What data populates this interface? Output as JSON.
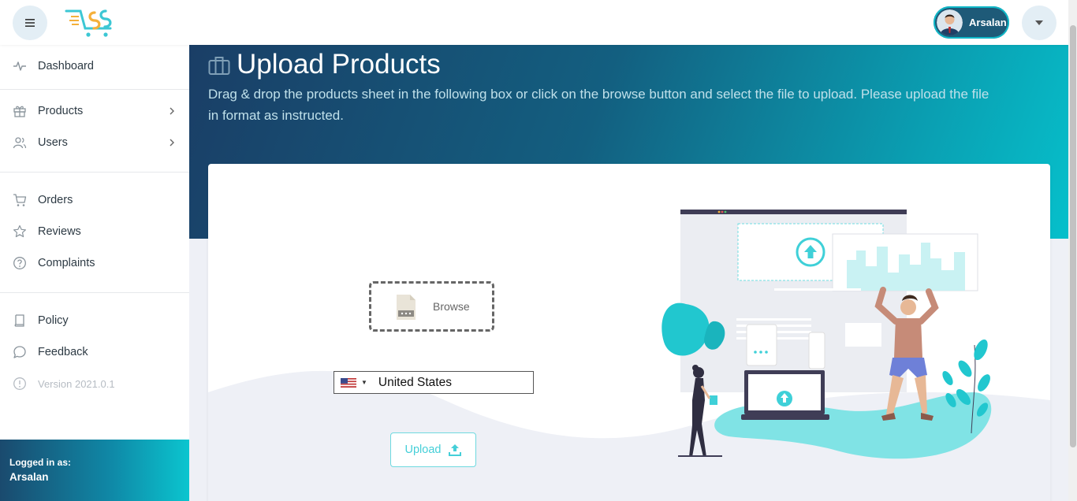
{
  "header": {
    "user_name": "Arsalan"
  },
  "sidebar": {
    "items": [
      {
        "label": "Dashboard",
        "icon": "activity-icon"
      },
      {
        "label": "Products",
        "icon": "gift-icon"
      },
      {
        "label": "Users",
        "icon": "users-icon"
      },
      {
        "label": "Orders",
        "icon": "cart-icon"
      },
      {
        "label": "Reviews",
        "icon": "star-icon"
      },
      {
        "label": "Complaints",
        "icon": "help-circle-icon"
      },
      {
        "label": "Policy",
        "icon": "book-icon"
      },
      {
        "label": "Feedback",
        "icon": "message-circle-icon"
      }
    ],
    "version": "Version 2021.0.1",
    "logged_in_label": "Logged in as:",
    "logged_in_user": "Arsalan"
  },
  "page": {
    "title": "Upload Products",
    "description": "Drag & drop the products sheet in the following box or click on the browse button and select the file to upload. Please upload the file in format as instructed."
  },
  "upload": {
    "browse_label": "Browse",
    "country_value": "United States",
    "upload_label": "Upload"
  },
  "colors": {
    "accent": "#0bc5cf",
    "hero_dark": "#1a3e66",
    "upload_text": "#45cfd8"
  }
}
